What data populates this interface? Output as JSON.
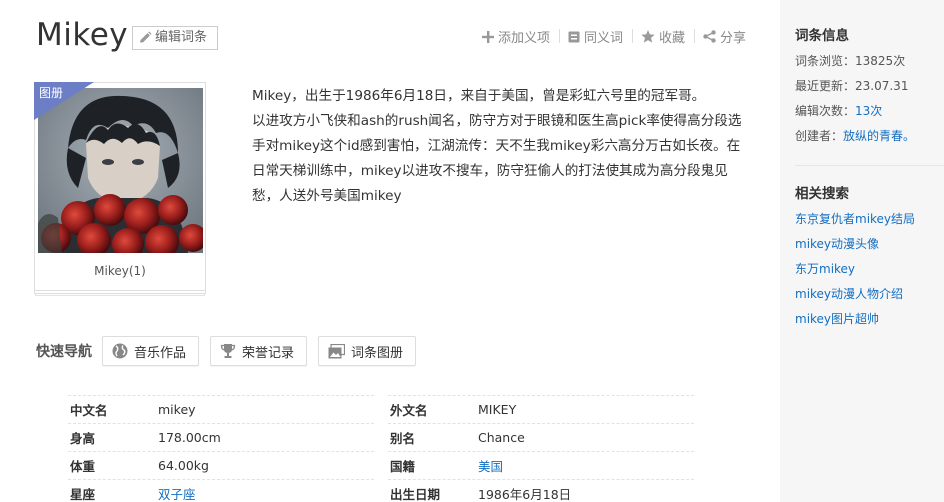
{
  "entry": {
    "title": "Mikey",
    "edit_label": "编辑词条"
  },
  "actions": [
    {
      "icon": "plus-icon",
      "label": "添加义项"
    },
    {
      "icon": "synonym-icon",
      "label": "同义词"
    },
    {
      "icon": "star-icon",
      "label": "收藏"
    },
    {
      "icon": "share-icon",
      "label": "分享"
    }
  ],
  "album": {
    "badge": "图册",
    "caption": "Mikey(1)"
  },
  "summary": {
    "p1": "Mikey，出生于1986年6月18日，来自于美国，曾是彩虹六号里的冠军哥。",
    "p2": "以进攻方小飞侠和ash的rush闻名，防守方对于眼镜和医生高pick率使得高分段选手对mikey这个id感到害怕，江湖流传：天不生我mikey彩六高分万古如长夜。在日常天梯训练中，mikey以进攻不搜车，防守狂偷人的打法使其成为高分段鬼见愁，人送外号美国mikey"
  },
  "quicknav": {
    "label": "快速导航",
    "buttons": [
      {
        "icon": "globe-icon",
        "label": "音乐作品"
      },
      {
        "icon": "trophy-icon",
        "label": "荣誉记录"
      },
      {
        "icon": "album-icon",
        "label": "词条图册"
      }
    ]
  },
  "basic_info": {
    "left": [
      {
        "key": "中文名",
        "value": "mikey",
        "link": false
      },
      {
        "key": "身高",
        "value": "178.00cm",
        "link": false
      },
      {
        "key": "体重",
        "value": "64.00kg",
        "link": false
      },
      {
        "key": "星座",
        "value": "双子座",
        "link": true
      }
    ],
    "right": [
      {
        "key": "外文名",
        "value": "MIKEY",
        "link": false
      },
      {
        "key": "别名",
        "value": "Chance",
        "link": false
      },
      {
        "key": "国籍",
        "value": "美国",
        "link": true
      },
      {
        "key": "出生日期",
        "value": "1986年6月18日",
        "link": false
      }
    ]
  },
  "sidebar": {
    "info_title": "词条信息",
    "views_label": "词条浏览：",
    "views_value": "13825次",
    "updated_label": "最近更新：",
    "updated_value": "23.07.31",
    "edits_label": "编辑次数：",
    "edits_value": "13次",
    "creator_label": "创建者：",
    "creator_value": "放纵的青春。",
    "related_title": "相关搜索",
    "related": [
      "东京复仇者mikey结局",
      "mikey动漫头像",
      "东万mikey",
      "mikey动漫人物介绍",
      "mikey图片超帅"
    ]
  },
  "colors": {
    "link": "#136ec2",
    "badge": "#6c7ec5",
    "sidebar_bg": "#f6f6f6"
  }
}
